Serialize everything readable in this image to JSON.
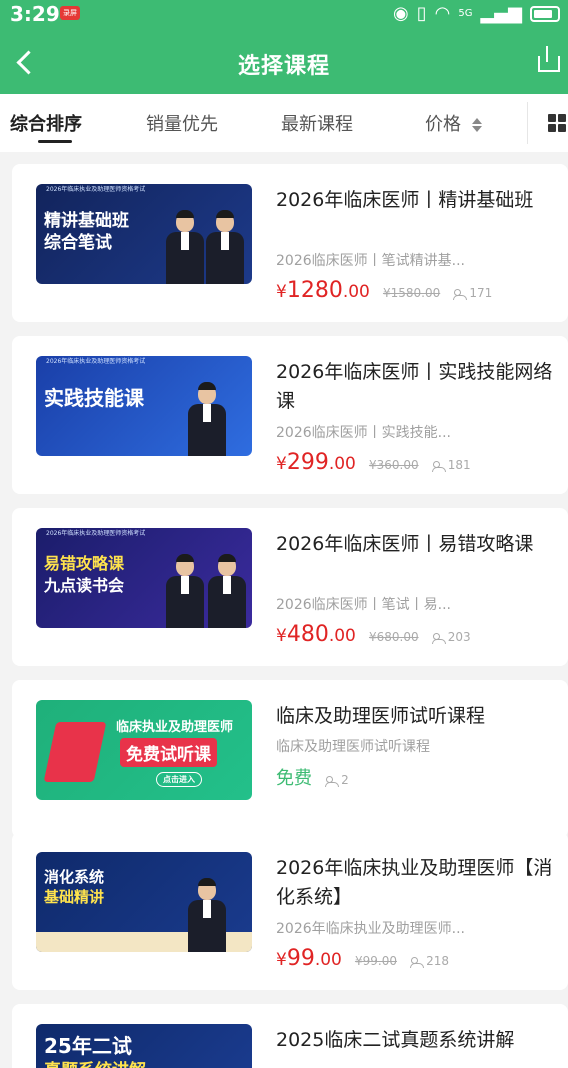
{
  "status_bar": {
    "time": "3:29",
    "rec_badge": "录屏",
    "network": "5G"
  },
  "header": {
    "title": "选择课程"
  },
  "sort_tabs": [
    {
      "label": "综合排序",
      "active": true
    },
    {
      "label": "销量优先",
      "active": false
    },
    {
      "label": "最新课程",
      "active": false
    },
    {
      "label": "价格",
      "active": false
    }
  ],
  "colors": {
    "brand_green": "#3dbb73",
    "price_red": "#e02424"
  },
  "courses": [
    {
      "title": "2026年临床医师丨精讲基础班",
      "subtitle": "2026临床医师丨笔试精讲基...",
      "price_symbol": "¥",
      "price_int": "1280",
      "price_dec": ".00",
      "original_price": "¥1580.00",
      "enrolled": "171",
      "thumb": {
        "line1": "精讲基础班",
        "line2": "综合笔试",
        "banner": "2026年临床执业及助理医师资格考试"
      }
    },
    {
      "title": "2026年临床医师丨实践技能网络课",
      "subtitle": "2026临床医师丨实践技能...",
      "price_symbol": "¥",
      "price_int": "299",
      "price_dec": ".00",
      "original_price": "¥360.00",
      "enrolled": "181",
      "thumb": {
        "line1": "实践技能课",
        "line2": "",
        "banner": "2026年临床执业及助理医师资格考试"
      }
    },
    {
      "title": "2026年临床医师丨易错攻略课",
      "subtitle": "2026临床医师丨笔试丨易...",
      "price_symbol": "¥",
      "price_int": "480",
      "price_dec": ".00",
      "original_price": "¥680.00",
      "enrolled": "203",
      "thumb": {
        "line1": "易错攻略课",
        "line2": "九点读书会",
        "banner": "2026年临床执业及助理医师资格考试"
      }
    },
    {
      "title": "临床及助理医师试听课程",
      "subtitle": "临床及助理医师试听课程",
      "free_label": "免费",
      "enrolled": "2",
      "thumb": {
        "line1": "临床执业及助理医师",
        "line2": "免费试听课",
        "banner": "点击进入"
      }
    },
    {
      "title": "2026年临床执业及助理医师【消化系统】",
      "subtitle": "2026年临床执业及助理医师...",
      "price_symbol": "¥",
      "price_int": "99",
      "price_dec": ".00",
      "original_price": "¥99.00",
      "enrolled": "218",
      "thumb": {
        "line1": "消化系统",
        "line2": "基础精讲",
        "banner": ""
      }
    },
    {
      "title": "2025临床二试真题系统讲解",
      "thumb": {
        "line1": "25年二试",
        "line2": "真题系统讲解",
        "banner": ""
      }
    }
  ]
}
